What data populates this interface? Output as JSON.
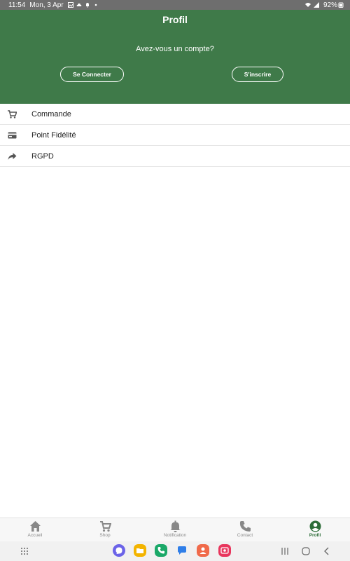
{
  "status_bar": {
    "time": "11:54",
    "date": "Mon, 3 Apr",
    "battery": "92%",
    "icons": [
      "image-icon",
      "cloud-icon",
      "bell-icon",
      "dot-icon",
      "wifi-icon",
      "signal-icon",
      "battery-icon"
    ]
  },
  "header": {
    "title": "Profil",
    "question": "Avez-vous un compte?",
    "login_label": "Se Connecter",
    "register_label": "S'inscrire"
  },
  "menu": {
    "items": [
      {
        "label": "Commande",
        "icon": "cart-icon"
      },
      {
        "label": "Point Fidélité",
        "icon": "card-icon"
      },
      {
        "label": "RGPD",
        "icon": "share-icon"
      }
    ]
  },
  "bottom_nav": {
    "tabs": [
      {
        "label": "Accueil",
        "icon": "home-icon"
      },
      {
        "label": "Shop",
        "icon": "cart-icon"
      },
      {
        "label": "Notification",
        "icon": "bell-icon"
      },
      {
        "label": "Contact",
        "icon": "phone-icon"
      },
      {
        "label": "Profil",
        "icon": "account-icon",
        "active": true
      }
    ]
  },
  "colors": {
    "header": "#3f7a49",
    "active_tab": "#2d6d39",
    "status_bar": "#6e6e6e"
  },
  "system_nav": {
    "dock_apps": [
      "messenger-app-icon",
      "files-app-icon",
      "phone-app-icon",
      "messages-app-icon",
      "contacts-app-icon",
      "screen-recorder-app-icon"
    ]
  }
}
